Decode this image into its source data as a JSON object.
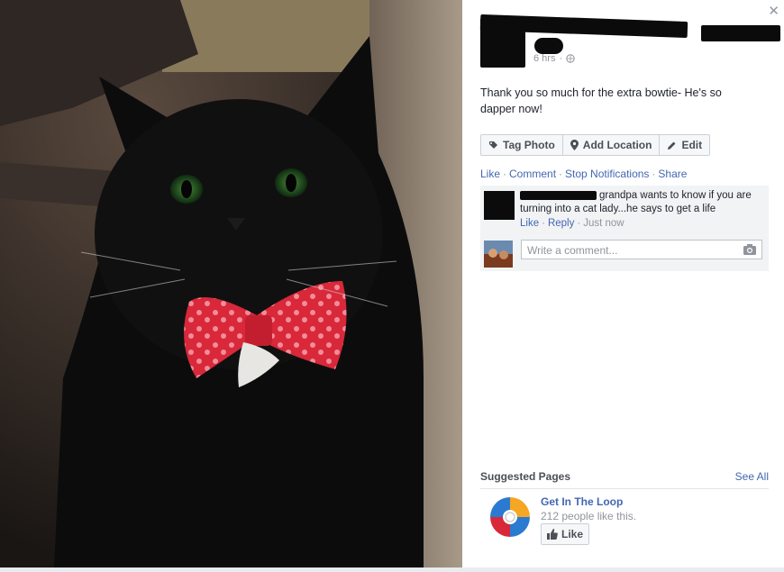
{
  "post": {
    "time": "6 hrs",
    "status": "Thank you so much for the extra bowtie- He's so dapper now!"
  },
  "photo_buttons": {
    "tag_photo": "Tag Photo",
    "add_location": "Add Location",
    "edit": "Edit"
  },
  "actions": {
    "like": "Like",
    "comment": "Comment",
    "stop_notifications": "Stop Notifications",
    "share": "Share"
  },
  "comment": {
    "text": "grandpa wants to know if you are turning into a cat lady...he says to get a life",
    "like": "Like",
    "reply": "Reply",
    "time": "Just now"
  },
  "write_comment": {
    "placeholder": "Write a comment..."
  },
  "suggested": {
    "title": "Suggested Pages",
    "see_all": "See All",
    "page_name": "Get In The Loop",
    "page_likes": "212 people like this.",
    "like_button": "Like"
  },
  "colors": {
    "link": "#4267b2",
    "background": "#e9ebee",
    "bowtie": "#e0303c"
  }
}
